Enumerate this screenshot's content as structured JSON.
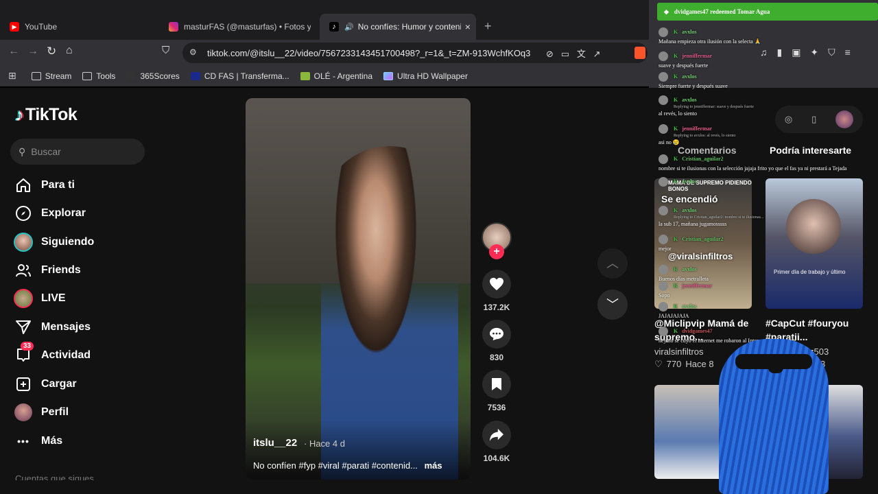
{
  "browser": {
    "tabs": [
      {
        "label": "YouTube",
        "active": false
      },
      {
        "label": "masturFAS (@masturfas) • Fotos y vid",
        "active": false
      },
      {
        "label": "No confíes: Humor y contenid",
        "active": true
      }
    ],
    "url": "tiktok.com/@itslu__22/video/7567233143451700498?_r=1&_t=ZM-913WchfKOq3",
    "bookmarks": [
      "Stream",
      "Tools",
      "365Scores",
      "CD FAS | Transferma...",
      "OLÉ - Argentina",
      "Ultra HD Wallpaper"
    ]
  },
  "tiktok": {
    "logo": "TikTok",
    "search_placeholder": "Buscar",
    "nav": [
      {
        "label": "Para ti",
        "icon": "home-icon"
      },
      {
        "label": "Explorar",
        "icon": "compass-icon"
      },
      {
        "label": "Siguiendo",
        "icon": "following-avatar-icon"
      },
      {
        "label": "Friends",
        "icon": "friends-icon"
      },
      {
        "label": "LIVE",
        "icon": "live-icon"
      },
      {
        "label": "Mensajes",
        "icon": "send-icon"
      },
      {
        "label": "Actividad",
        "icon": "inbox-icon",
        "badge": "33"
      },
      {
        "label": "Cargar",
        "icon": "plus-square-icon"
      },
      {
        "label": "Perfil",
        "icon": "profile-avatar-icon"
      },
      {
        "label": "Más",
        "icon": "more-icon"
      }
    ],
    "following_header": "Cuentas que sigues",
    "video": {
      "author": "itslu__22",
      "time": "· Hace 4 d",
      "caption": "No confíen #fyp #viral #parati #contenid...",
      "more": "más"
    },
    "actions": {
      "likes": "137.2K",
      "comments": "830",
      "saves": "7536",
      "shares": "104.6K"
    },
    "panel_tabs": [
      "Comentarios",
      "Podría interesarte"
    ],
    "recommended": [
      {
        "title": "@Miclipvip Mamá de supremo...",
        "overlay": "MAMÁ DE SUPREMO PIDIENDO BONOS",
        "overlay2": "Se encendió",
        "overlay3": "@viralsinfiltros",
        "author": "viralsinfiltros",
        "likes": "770",
        "time": "Hace 8"
      },
      {
        "title": "#CapCut #fouryou #paratii...",
        "overlay": "Primer día de trabajo y último",
        "author": "z503",
        "likes": "",
        "time": "3"
      }
    ]
  },
  "stream_overlay": {
    "alert": "dvidgames47 redeemed Tomar Agua",
    "messages": [
      {
        "user": "avxlos",
        "text": "Mañana empieza otra ilusión con la selecta 🙏",
        "color": "#6fd16f"
      },
      {
        "user": "jenniffermar",
        "text": "suave y después fuerte",
        "color": "#e05a8a"
      },
      {
        "user": "avxlos",
        "text": "Siempre fuerte y después suave",
        "color": "#6fd16f"
      },
      {
        "user": "avxlos",
        "text": "al revés, lo siento",
        "reply": "Replying to jenniffermar: suave y después fuerte",
        "color": "#6fd16f"
      },
      {
        "user": "jenniffermar",
        "text": "asi no 😢",
        "reply": "Replying to avxlos: al revés, lo siento",
        "color": "#e05a8a"
      },
      {
        "user": "Cristian_aguilar2",
        "text": "nombre si te ilusionas con la selección jajaja frito yo que el fas ya ni prestará a Tejada",
        "color": "#5fbf5f"
      },
      {
        "user": "avxlos",
        "text": "",
        "color": "#6fd16f"
      },
      {
        "user": "avxlos",
        "text": "la sub 17, mañana jugamosssss",
        "reply": "Replying to Cristian_aguilar2: nombre si te ilusionas...",
        "color": "#6fd16f"
      },
      {
        "user": "Cristian_aguilar2",
        "text": "mejor",
        "color": "#5fbf5f"
      },
      {
        "user": "avxlos",
        "text": "Buenos días metralleta",
        "color": "#6fd16f"
      },
      {
        "user": "jenniffermar",
        "text": "Sopo",
        "color": "#e05a8a"
      },
      {
        "user": "avxlos",
        "text": "JAJAJAJAJA",
        "color": "#6fd16f"
      },
      {
        "user": "dvidgames47",
        "text": "hey no sé cuyo el internet me robaron al Inter estos del alcalde",
        "color": "#c05050"
      }
    ]
  },
  "colors": {
    "accent": "#fe2c55",
    "alert_green": "#3fae2e",
    "page_bg": "#121212"
  }
}
